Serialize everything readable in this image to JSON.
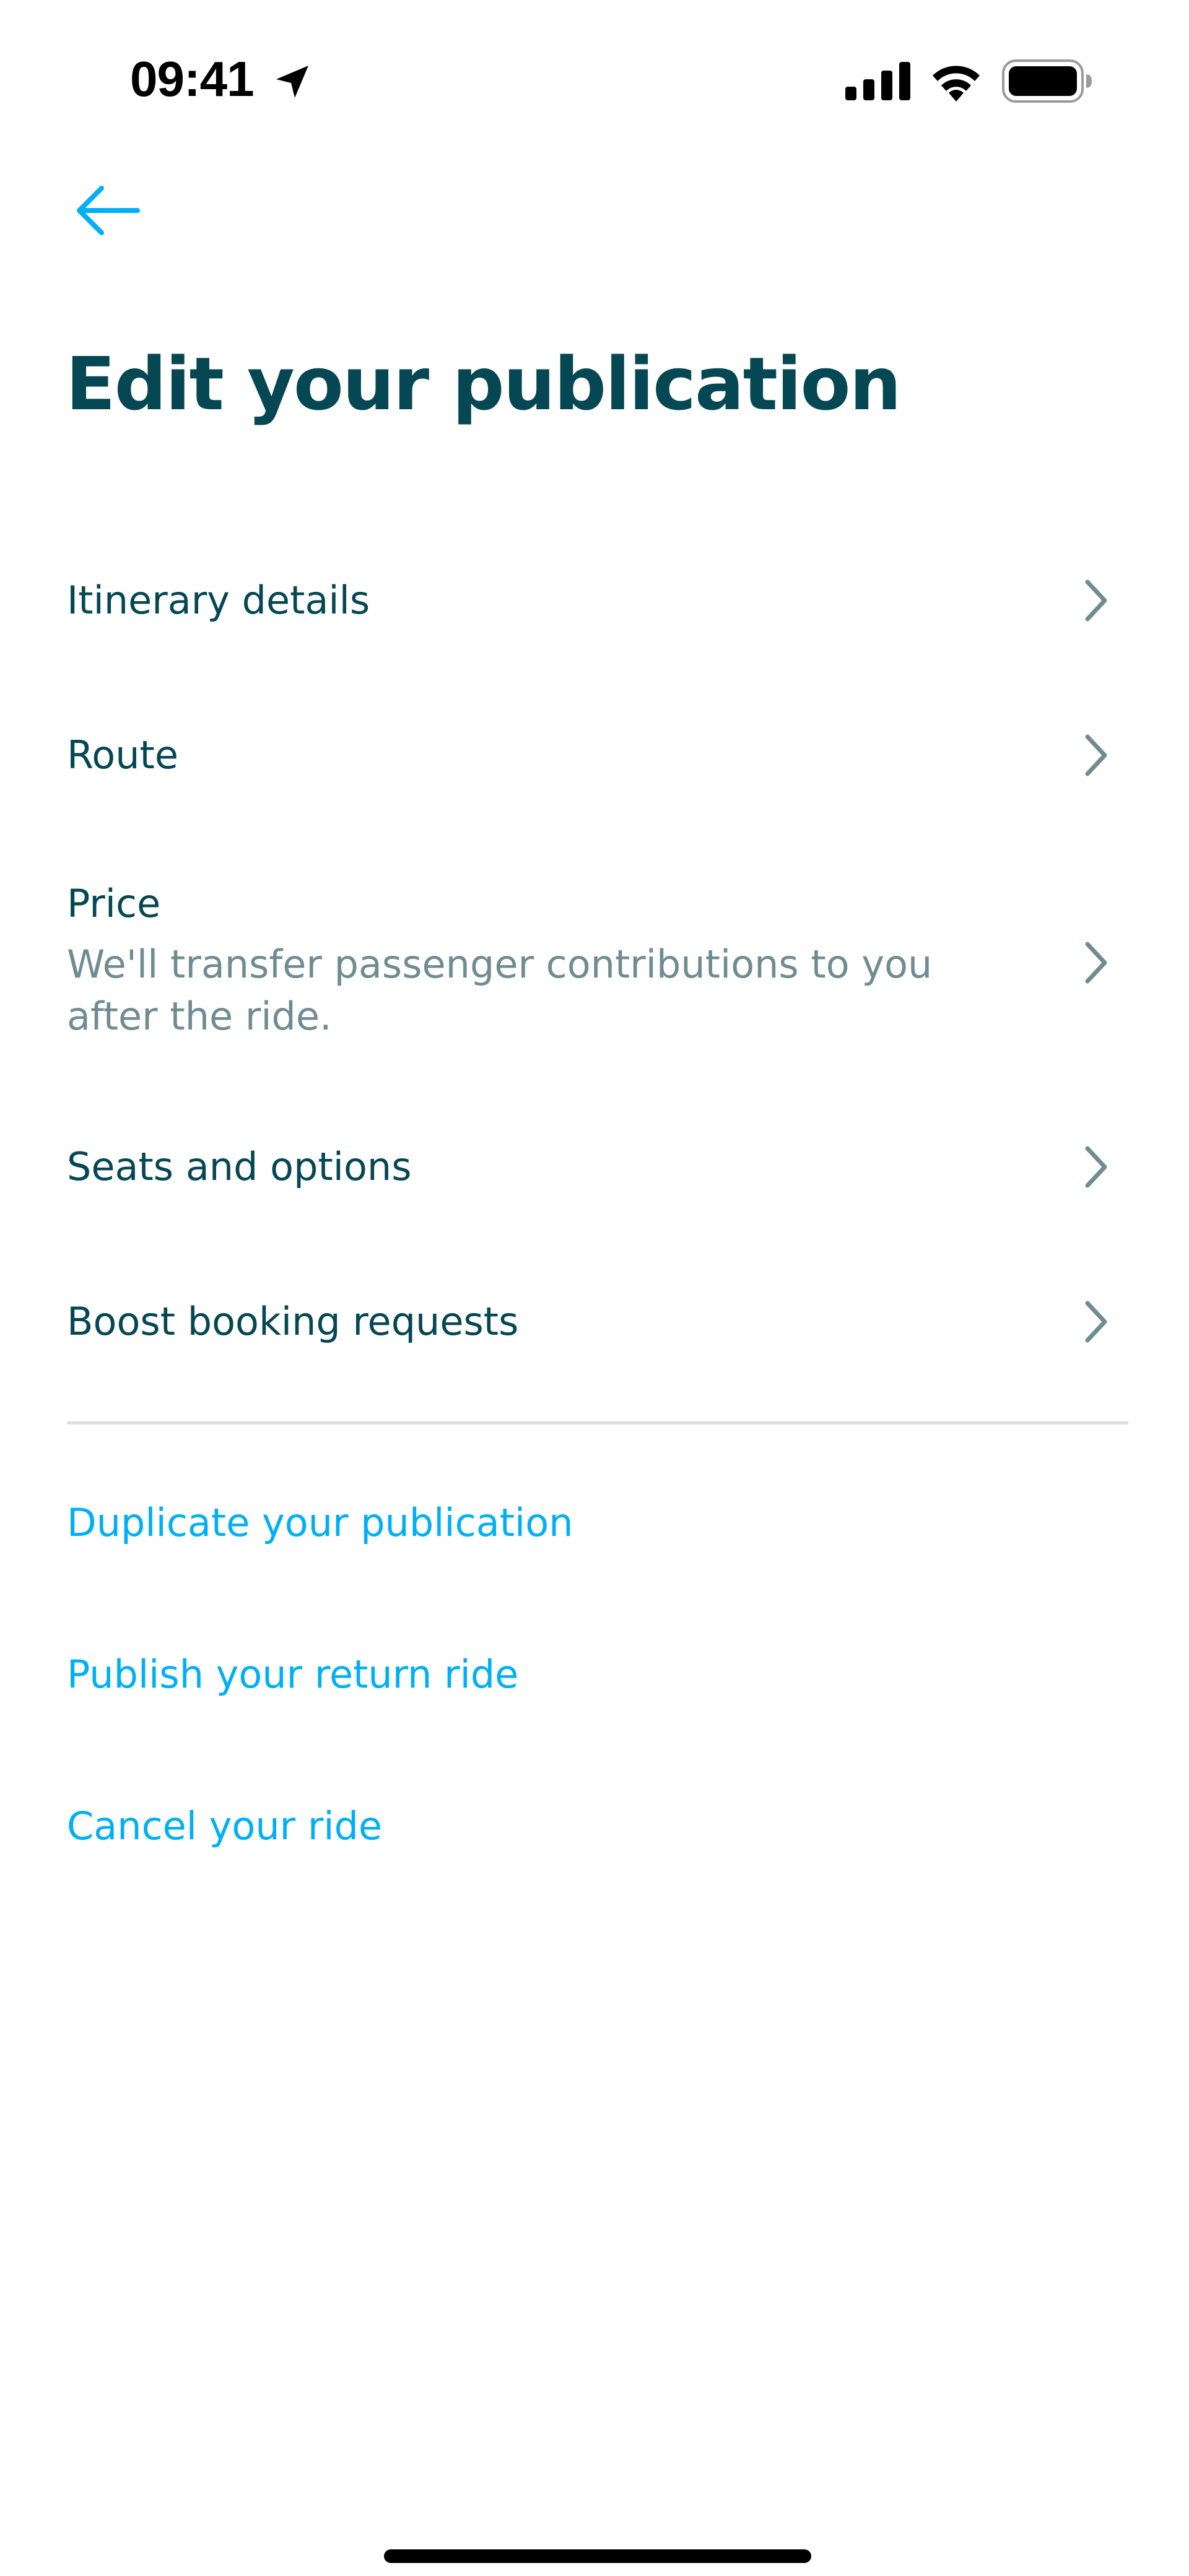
{
  "status_bar": {
    "time": "09:41"
  },
  "header": {
    "back_icon": "arrow-left-icon",
    "title": "Edit your publication"
  },
  "menu": {
    "items": [
      {
        "label": "Itinerary details",
        "icon": "chevron-right-icon"
      },
      {
        "label": "Route",
        "icon": "chevron-right-icon"
      },
      {
        "label": "Price",
        "sublabel": "We'll transfer passenger contributions to you after the ride.",
        "icon": "chevron-right-icon"
      },
      {
        "label": "Seats and options",
        "icon": "chevron-right-icon"
      },
      {
        "label": "Boost booking requests",
        "icon": "chevron-right-icon"
      }
    ]
  },
  "actions": {
    "duplicate": "Duplicate your publication",
    "publish_return": "Publish your return ride",
    "cancel": "Cancel your ride"
  },
  "colors": {
    "primary_text": "#054752",
    "secondary_text": "#708c91",
    "accent": "#00aff5",
    "divider": "#dddddd"
  }
}
